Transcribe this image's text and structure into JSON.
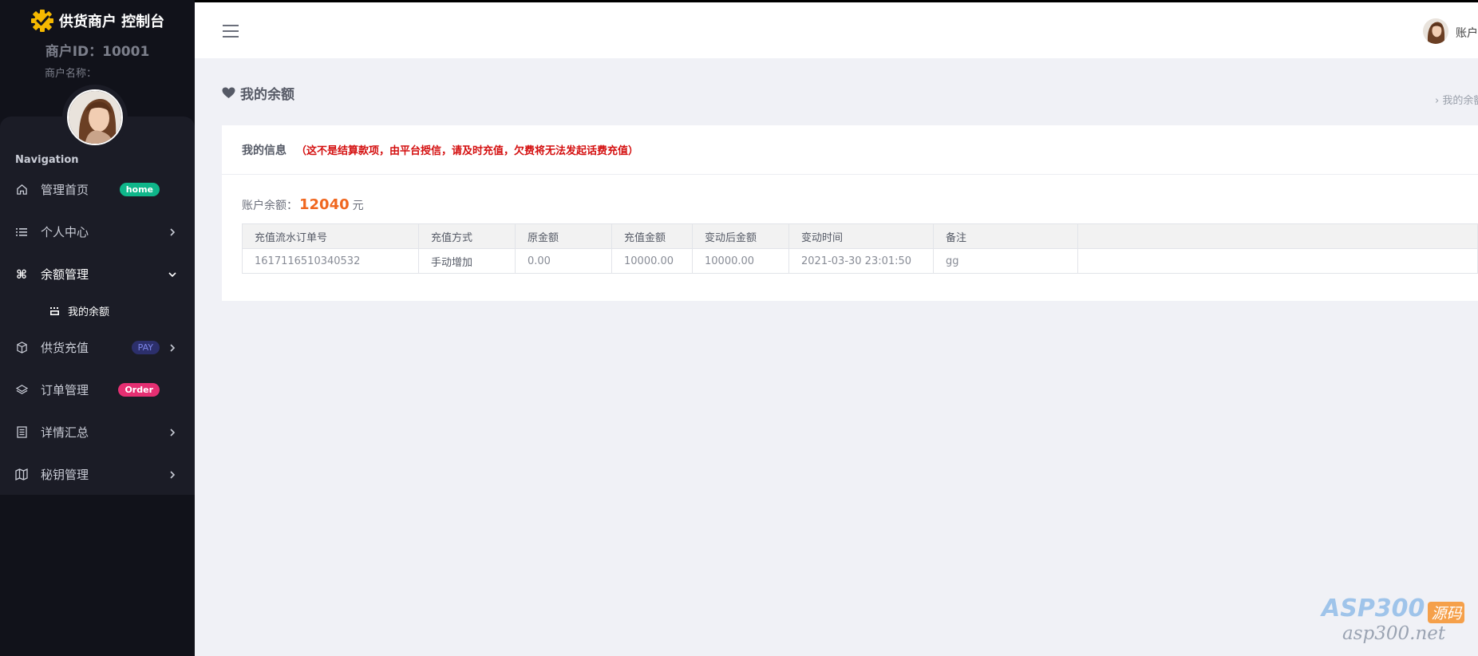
{
  "brand": {
    "title": "供货商户 控制台"
  },
  "merchant": {
    "id_line": "商户ID：10001",
    "name_line": "商户名称："
  },
  "nav": {
    "heading": "Navigation",
    "items": [
      {
        "label": "管理首页",
        "icon": "home-icon",
        "badge": "home"
      },
      {
        "label": "个人中心",
        "icon": "list-icon"
      },
      {
        "label": "余额管理",
        "icon": "command-icon"
      },
      {
        "label": "供货充值",
        "icon": "box-icon",
        "badge": "PAY"
      },
      {
        "label": "订单管理",
        "icon": "layers-icon",
        "badge": "Order"
      },
      {
        "label": "详情汇总",
        "icon": "document-icon"
      },
      {
        "label": "秘钥管理",
        "icon": "map-icon"
      }
    ],
    "sub_item": {
      "label": "我的余额",
      "icon": "wallet-icon"
    }
  },
  "topbar": {
    "account_label": "账户"
  },
  "page": {
    "title": "我的余额",
    "breadcrumb": "›   我的余额"
  },
  "card": {
    "title": "我的信息",
    "warning": "（这不是结算款项，由平台授信，请及时充值，欠费将无法发起话费充值）",
    "balance_label": "账户余额：",
    "balance_amount": "12040",
    "balance_unit": "元"
  },
  "table": {
    "headers": [
      "充值流水订单号",
      "充值方式",
      "原金额",
      "充值金额",
      "变动后金额",
      "变动时间",
      "备注",
      ""
    ],
    "rows": [
      [
        "1617116510340532",
        "手动增加",
        "0.00",
        "10000.00",
        "10000.00",
        "2021-03-30 23:01:50",
        "gg",
        ""
      ]
    ]
  },
  "watermark": {
    "top": "ASP300",
    "tag": "源码",
    "bottom": "asp300.net"
  },
  "colors": {
    "sidebar_bg": "#11121a",
    "accent_orange": "#f0671f",
    "warning_red": "#d40f0f",
    "badge_green": "#0fb68a",
    "badge_pink": "#e52f72"
  }
}
